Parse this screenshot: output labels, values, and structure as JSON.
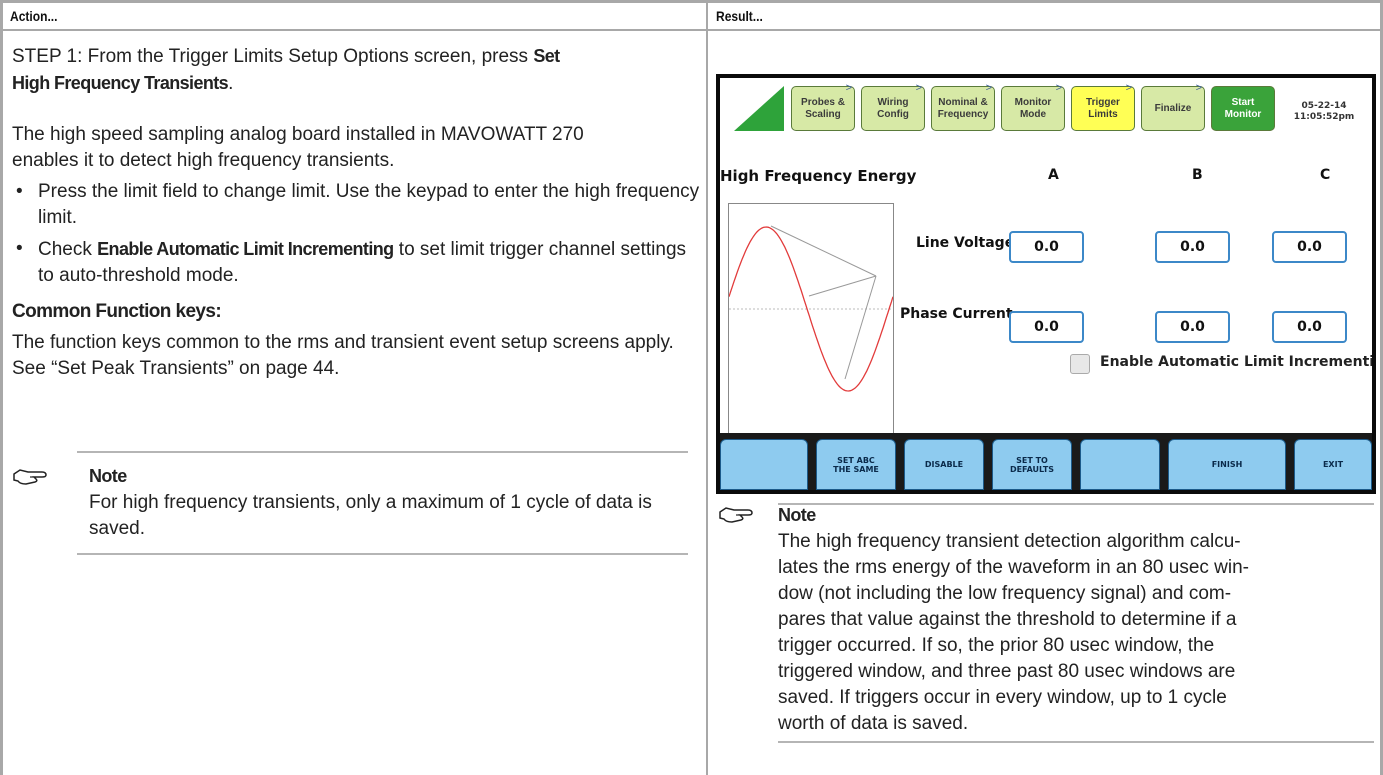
{
  "header": {
    "action": "Action...",
    "result": "Result..."
  },
  "left": {
    "step1_prefix": "STEP 1: From the Trigger Limits Setup Options screen, press ",
    "step1_bold_a": "Set",
    "step1_bold_b": "High Frequency Transients",
    "step1_suffix": ".",
    "para_line1": "The high speed sampling analog board installed in MAVOWATT 270",
    "para_line2": "enables it to detect high frequency transients.",
    "bullet1": "Press the limit field to change limit. Use the keypad to enter the high frequency limit.",
    "bullet2_prefix": "Check ",
    "bullet2_bold": "Enable Automatic Limit Incrementing",
    "bullet2_suffix": " to set limit trigger channel settings to auto-threshold mode.",
    "subhead": "Common Function keys:",
    "func_text": "The function keys common to the rms and transient event setup screens apply. See “Set Peak Transients” on page 44.",
    "note_title": "Note",
    "note_text": "For high frequency transients, only a maximum of 1 cycle of data is saved."
  },
  "device": {
    "tabs": [
      {
        "label": "Probes & Scaling"
      },
      {
        "label": "Wiring Config"
      },
      {
        "label": "Nominal & Frequency"
      },
      {
        "label": "Monitor Mode"
      },
      {
        "label": "Trigger Limits"
      },
      {
        "label": "Finalize"
      },
      {
        "label": "Start Monitor"
      }
    ],
    "tab_arrow": ">",
    "date": "05-22-14",
    "time": "11:05:52pm",
    "title": "High Frequency Energy",
    "col_a": "A",
    "col_b": "B",
    "col_c": "C",
    "row1_label": "Line Voltage",
    "row2_label": "Phase Current",
    "row1_values": [
      "0.0",
      "0.0",
      "0.0"
    ],
    "row2_values": [
      "0.0",
      "0.0",
      "0.0"
    ],
    "checkbox_label": "Enable Automatic Limit Incrementing",
    "fkeys": [
      "",
      "SET ABC THE SAME",
      "DISABLE",
      "SET TO DEFAULTS",
      "",
      "FINISH",
      "EXIT"
    ]
  },
  "right_note": {
    "title": "Note",
    "text": "The high frequency transient detection algorithm calculates the rms energy of the waveform in an 80 usec window (not including the low frequency signal) and compares that value against the threshold to determine if a trigger occurred. If so, the prior 80 usec window, the triggered window, and three past 80 usec windows are saved. If triggers occur in every window, up to 1 cycle worth of data is saved.",
    "lines": [
      "The high frequency transient detection algorithm calcu-",
      "lates the rms energy of the waveform in an 80 usec win-",
      "dow (not including the low frequency signal) and com-",
      "pares that value against the threshold to determine if a",
      "trigger occurred. If so, the prior 80 usec window, the",
      "triggered window, and three past 80 usec windows are",
      "saved. If triggers occur in every window, up to 1 cycle",
      "worth of data is saved."
    ]
  }
}
